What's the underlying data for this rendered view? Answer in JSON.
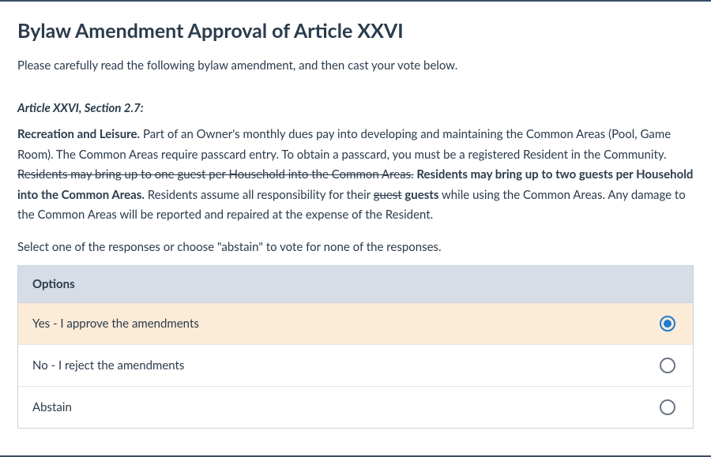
{
  "heading": "Bylaw Amendment Approval of Article XXVI",
  "intro": "Please carefully read the following bylaw amendment, and then cast your vote below.",
  "article_title": "Article XXVI, Section 2.7:",
  "body": {
    "lead": "Recreation and Leisure.",
    "p1": " Part of an Owner's monthly dues pay into developing and maintaining the Common Areas (Pool, Game Room). The Common Areas require passcard entry. To obtain a passcard, you must be a registered Resident in the Community. ",
    "strike1": "Residents may bring up to one guest per Household into the Common Areas.",
    "add1": " Residents may bring up to two guests per Household into the Common Areas.",
    "p2a": " Residents assume all responsibility for their ",
    "strike2": "guest",
    "add2": " guests",
    "p2b": " while using the Common Areas. Any damage to the Common Areas will be reported and repaired at the expense of the Resident."
  },
  "select_hint": "Select one of the responses or choose \"abstain\" to vote for none of the responses.",
  "options_header": "Options",
  "options": [
    {
      "label": "Yes - I approve the amendments",
      "selected": true
    },
    {
      "label": "No - I reject the amendments",
      "selected": false
    },
    {
      "label": "Abstain",
      "selected": false
    }
  ]
}
